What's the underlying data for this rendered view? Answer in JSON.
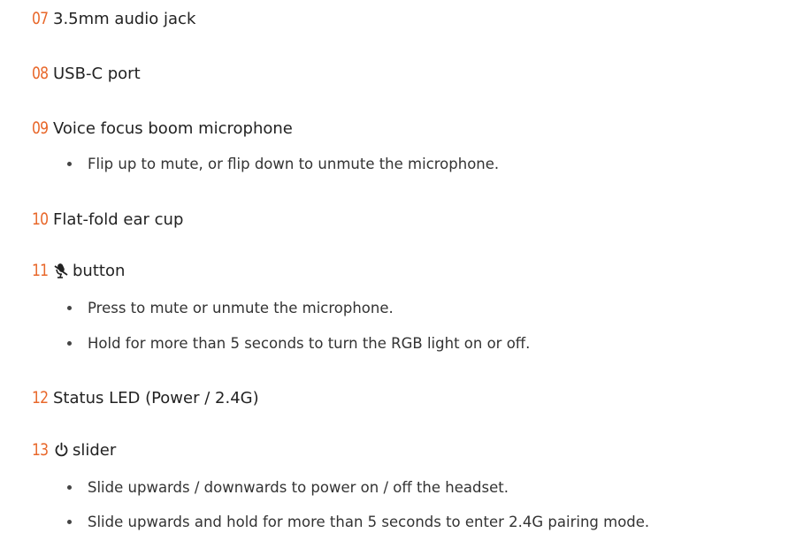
{
  "items": [
    {
      "number": "07",
      "title": "3.5mm audio jack",
      "bullets": []
    },
    {
      "number": "08",
      "title": "USB-C port",
      "bullets": []
    },
    {
      "number": "09",
      "title": "Voice focus boom microphone",
      "bullets": [
        "Flip up to mute, or flip down to unmute the microphone."
      ]
    },
    {
      "number": "10",
      "title": "Flat-fold ear cup",
      "bullets": []
    },
    {
      "number": "11",
      "icon": "mic-mute-icon",
      "title": "button",
      "bullets": [
        "Press to mute or unmute the microphone.",
        "Hold for more than 5 seconds to turn the RGB light on or off."
      ]
    },
    {
      "number": "12",
      "title": "Status LED (Power / 2.4G)",
      "bullets": []
    },
    {
      "number": "13",
      "icon": "power-icon",
      "title": "slider",
      "bullets": [
        "Slide upwards / downwards to power on / off the headset.",
        "Slide upwards and hold for more than 5 seconds to enter 2.4G pairing mode."
      ]
    }
  ],
  "colors": {
    "accent": "#e8672a",
    "text": "#222222"
  }
}
